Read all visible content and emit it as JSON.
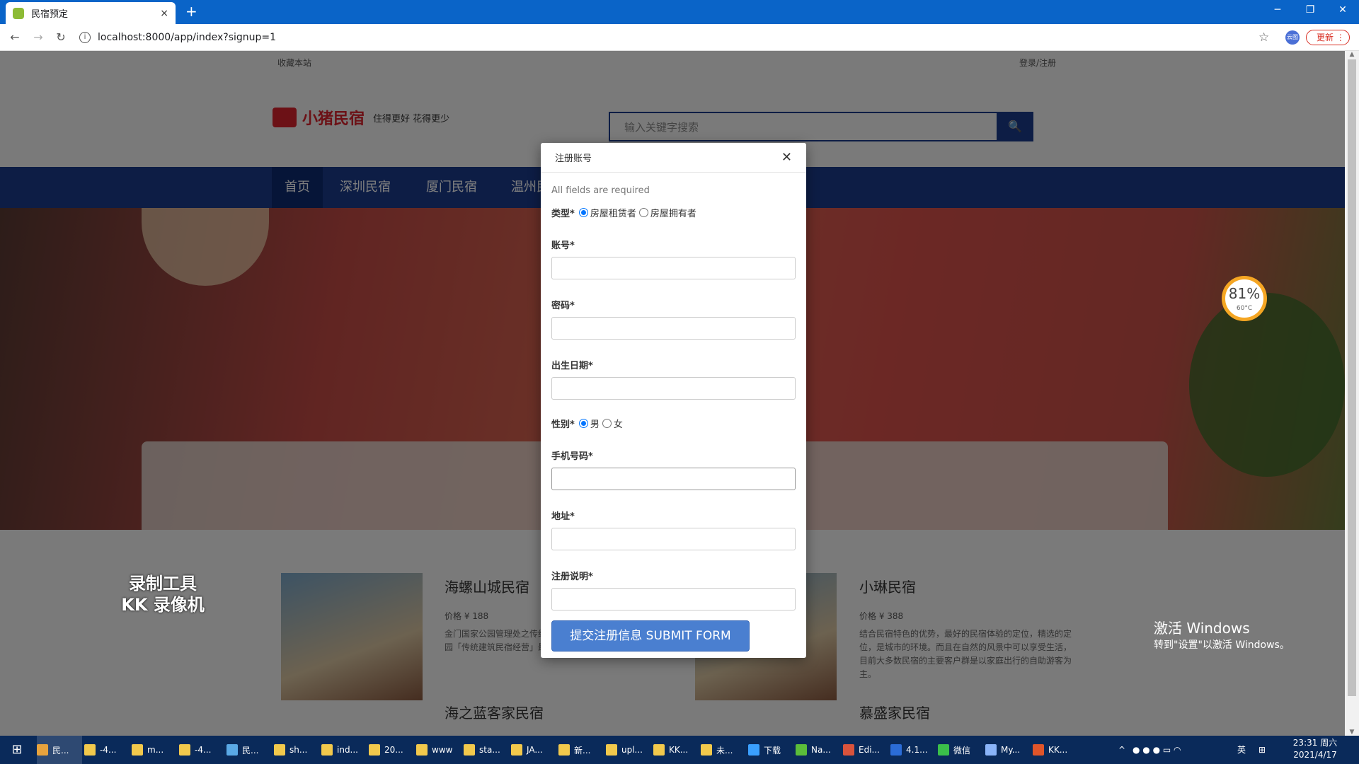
{
  "browser": {
    "tab_title": "民宿预定",
    "tab_close": "×",
    "new_tab": "+",
    "url": "localhost:8000/app/index?signup=1",
    "info_icon": "i",
    "star": "☆",
    "ext_label": "云图",
    "update_label": "更新",
    "update_menu": "⋮",
    "minimize": "─",
    "restore": "❐",
    "close": "✕",
    "back": "←",
    "forward": "→",
    "reload": "↻"
  },
  "page": {
    "top_fav": "收藏本站",
    "top_login": "登录/注册",
    "logo_text": "小猪民宿",
    "slogan": "住得更好 花得更少",
    "search_placeholder": "输入关键字搜索",
    "search_icon": "🔍",
    "nav": [
      "首页",
      "深圳民宿",
      "厦门民宿",
      "温州民宿"
    ],
    "listings": [
      {
        "title": "海螺山城民宿",
        "price": "价格 ¥ 188",
        "desc": "金门国家公园管理处之传统建筑修复经营，是金门国家公园「传统建筑民宿经营」最具特色之一。"
      },
      {
        "title": "小琳民宿",
        "price": "价格 ¥ 388",
        "desc": "结合民宿特色的优势，最好的民宿体验的定位，精选的定位，是城市的环境。而且在自然的风景中可以享受生活，目前大多数民宿的主要客户群是以家庭出行的自助游客为主。"
      }
    ],
    "listing_sub": [
      "海之蓝客家民宿",
      "慕盛家民宿"
    ],
    "kk_line1": "录制工具",
    "kk_line2": "KK 录像机",
    "activate_title": "激活 Windows",
    "activate_sub": "转到\"设置\"以激活 Windows。",
    "gauge_pct": "81%",
    "gauge_temp": "60°C"
  },
  "modal": {
    "title": "注册账号",
    "close": "✕",
    "required_note": "All fields are required",
    "type_label": "类型*",
    "type_options": [
      "房屋租赁者",
      "房屋拥有者"
    ],
    "type_selected": "房屋租赁者",
    "account_label": "账号*",
    "password_label": "密码*",
    "birth_label": "出生日期*",
    "gender_label": "性别*",
    "gender_options": [
      "男",
      "女"
    ],
    "gender_selected": "男",
    "phone_label": "手机号码*",
    "address_label": "地址*",
    "note_label": "注册说明*",
    "submit_label": "提交注册信息 SUBMIT FORM"
  },
  "taskbar": {
    "start": "⊞",
    "items": [
      "民...",
      "-4...",
      "m...",
      "-4...",
      "民...",
      "sh...",
      "ind...",
      "20...",
      "www",
      "sta...",
      "JA...",
      "新...",
      "upl...",
      "KK...",
      "未...",
      "下载",
      "Na...",
      "Edi...",
      "4.1...",
      "微信",
      "My...",
      "KK..."
    ],
    "ime": "英",
    "time": "23:31 周六",
    "date": "2021/4/17"
  },
  "colors": {
    "accent": "#1a3a8a",
    "brand_red": "#d9232d",
    "submit": "#4a7fd0",
    "tabstrip": "#0a64c8"
  }
}
